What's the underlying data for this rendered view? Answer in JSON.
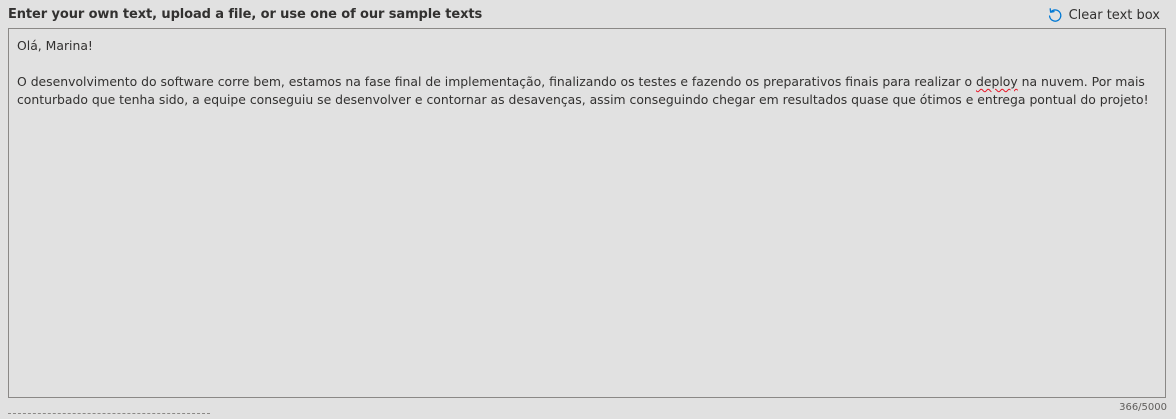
{
  "header": {
    "instructions": "Enter your own text, upload a file, or use one of our sample texts",
    "clear_label": "Clear text box",
    "clear_icon": "undo-arrow-icon",
    "accent_color": "#0078d4"
  },
  "textbox": {
    "greeting": "Olá, Marina!",
    "body_before": "O desenvolvimento do software corre bem, estamos na fase final de implementação, finalizando os testes e fazendo os preparativos finais para realizar o ",
    "misspelled_word": "deploy",
    "body_after": " na nuvem. Por mais conturbado que tenha sido, a equipe conseguiu se desenvolver e contornar as desavenças, assim conseguindo chegar em resultados quase que ótimos e entrega pontual do projeto!",
    "spellcheck_color": "#e81123"
  },
  "counter": "366/5000"
}
